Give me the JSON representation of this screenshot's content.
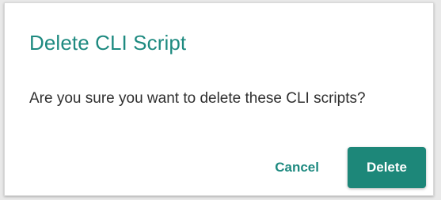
{
  "dialog": {
    "title": "Delete CLI Script",
    "message": "Are you sure you want to delete these CLI scripts?",
    "cancel_label": "Cancel",
    "delete_label": "Delete"
  },
  "colors": {
    "accent": "#1e8a80",
    "primary_button": "#1d8779",
    "text": "#2f2f2f"
  }
}
